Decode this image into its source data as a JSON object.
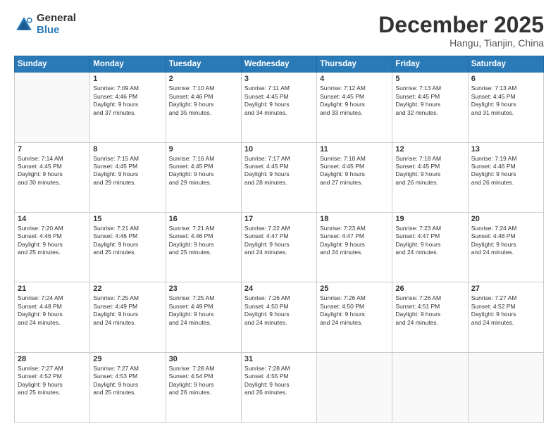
{
  "header": {
    "logo": {
      "general": "General",
      "blue": "Blue"
    },
    "title": "December 2025",
    "location": "Hangu, Tianjin, China"
  },
  "days_of_week": [
    "Sunday",
    "Monday",
    "Tuesday",
    "Wednesday",
    "Thursday",
    "Friday",
    "Saturday"
  ],
  "weeks": [
    [
      {
        "num": "",
        "info": ""
      },
      {
        "num": "1",
        "info": "Sunrise: 7:09 AM\nSunset: 4:46 PM\nDaylight: 9 hours\nand 37 minutes."
      },
      {
        "num": "2",
        "info": "Sunrise: 7:10 AM\nSunset: 4:46 PM\nDaylight: 9 hours\nand 35 minutes."
      },
      {
        "num": "3",
        "info": "Sunrise: 7:11 AM\nSunset: 4:45 PM\nDaylight: 9 hours\nand 34 minutes."
      },
      {
        "num": "4",
        "info": "Sunrise: 7:12 AM\nSunset: 4:45 PM\nDaylight: 9 hours\nand 33 minutes."
      },
      {
        "num": "5",
        "info": "Sunrise: 7:13 AM\nSunset: 4:45 PM\nDaylight: 9 hours\nand 32 minutes."
      },
      {
        "num": "6",
        "info": "Sunrise: 7:13 AM\nSunset: 4:45 PM\nDaylight: 9 hours\nand 31 minutes."
      }
    ],
    [
      {
        "num": "7",
        "info": "Sunrise: 7:14 AM\nSunset: 4:45 PM\nDaylight: 9 hours\nand 30 minutes."
      },
      {
        "num": "8",
        "info": "Sunrise: 7:15 AM\nSunset: 4:45 PM\nDaylight: 9 hours\nand 29 minutes."
      },
      {
        "num": "9",
        "info": "Sunrise: 7:16 AM\nSunset: 4:45 PM\nDaylight: 9 hours\nand 29 minutes."
      },
      {
        "num": "10",
        "info": "Sunrise: 7:17 AM\nSunset: 4:45 PM\nDaylight: 9 hours\nand 28 minutes."
      },
      {
        "num": "11",
        "info": "Sunrise: 7:18 AM\nSunset: 4:45 PM\nDaylight: 9 hours\nand 27 minutes."
      },
      {
        "num": "12",
        "info": "Sunrise: 7:18 AM\nSunset: 4:45 PM\nDaylight: 9 hours\nand 26 minutes."
      },
      {
        "num": "13",
        "info": "Sunrise: 7:19 AM\nSunset: 4:46 PM\nDaylight: 9 hours\nand 26 minutes."
      }
    ],
    [
      {
        "num": "14",
        "info": "Sunrise: 7:20 AM\nSunset: 4:46 PM\nDaylight: 9 hours\nand 25 minutes."
      },
      {
        "num": "15",
        "info": "Sunrise: 7:21 AM\nSunset: 4:46 PM\nDaylight: 9 hours\nand 25 minutes."
      },
      {
        "num": "16",
        "info": "Sunrise: 7:21 AM\nSunset: 4:46 PM\nDaylight: 9 hours\nand 25 minutes."
      },
      {
        "num": "17",
        "info": "Sunrise: 7:22 AM\nSunset: 4:47 PM\nDaylight: 9 hours\nand 24 minutes."
      },
      {
        "num": "18",
        "info": "Sunrise: 7:23 AM\nSunset: 4:47 PM\nDaylight: 9 hours\nand 24 minutes."
      },
      {
        "num": "19",
        "info": "Sunrise: 7:23 AM\nSunset: 4:47 PM\nDaylight: 9 hours\nand 24 minutes."
      },
      {
        "num": "20",
        "info": "Sunrise: 7:24 AM\nSunset: 4:48 PM\nDaylight: 9 hours\nand 24 minutes."
      }
    ],
    [
      {
        "num": "21",
        "info": "Sunrise: 7:24 AM\nSunset: 4:48 PM\nDaylight: 9 hours\nand 24 minutes."
      },
      {
        "num": "22",
        "info": "Sunrise: 7:25 AM\nSunset: 4:49 PM\nDaylight: 9 hours\nand 24 minutes."
      },
      {
        "num": "23",
        "info": "Sunrise: 7:25 AM\nSunset: 4:49 PM\nDaylight: 9 hours\nand 24 minutes."
      },
      {
        "num": "24",
        "info": "Sunrise: 7:26 AM\nSunset: 4:50 PM\nDaylight: 9 hours\nand 24 minutes."
      },
      {
        "num": "25",
        "info": "Sunrise: 7:26 AM\nSunset: 4:50 PM\nDaylight: 9 hours\nand 24 minutes."
      },
      {
        "num": "26",
        "info": "Sunrise: 7:26 AM\nSunset: 4:51 PM\nDaylight: 9 hours\nand 24 minutes."
      },
      {
        "num": "27",
        "info": "Sunrise: 7:27 AM\nSunset: 4:52 PM\nDaylight: 9 hours\nand 24 minutes."
      }
    ],
    [
      {
        "num": "28",
        "info": "Sunrise: 7:27 AM\nSunset: 4:52 PM\nDaylight: 9 hours\nand 25 minutes."
      },
      {
        "num": "29",
        "info": "Sunrise: 7:27 AM\nSunset: 4:53 PM\nDaylight: 9 hours\nand 25 minutes."
      },
      {
        "num": "30",
        "info": "Sunrise: 7:28 AM\nSunset: 4:54 PM\nDaylight: 9 hours\nand 26 minutes."
      },
      {
        "num": "31",
        "info": "Sunrise: 7:28 AM\nSunset: 4:55 PM\nDaylight: 9 hours\nand 26 minutes."
      },
      {
        "num": "",
        "info": ""
      },
      {
        "num": "",
        "info": ""
      },
      {
        "num": "",
        "info": ""
      }
    ]
  ]
}
